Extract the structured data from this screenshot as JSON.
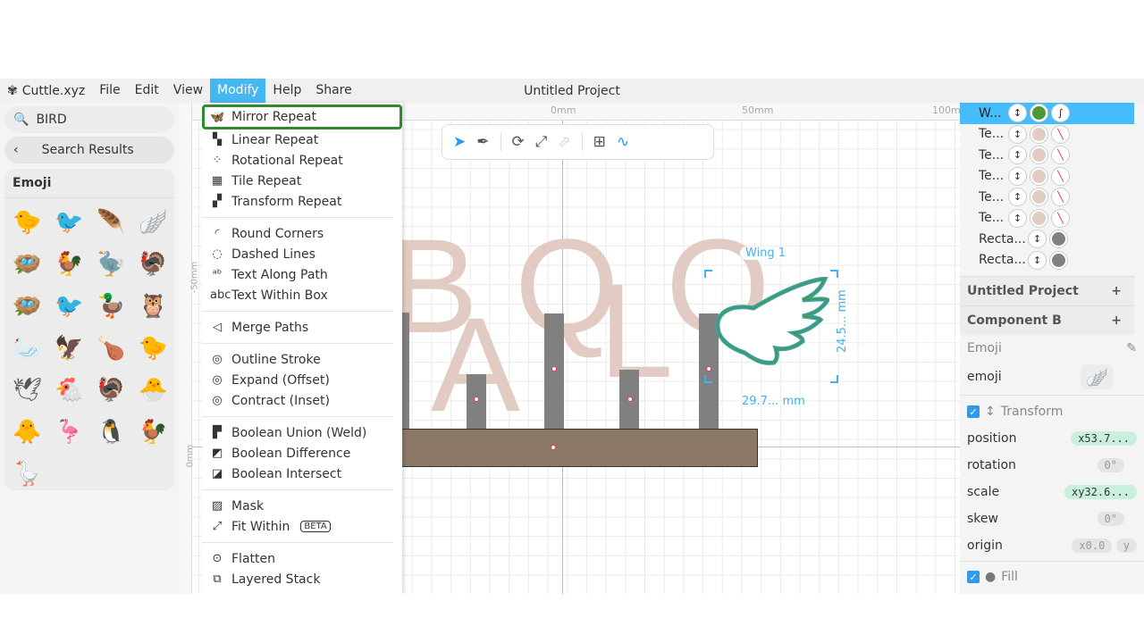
{
  "menubar": {
    "app": "Cuttle.xyz",
    "items": [
      "File",
      "Edit",
      "View",
      "Modify",
      "Help",
      "Share"
    ],
    "active": "Modify",
    "title": "Untitled Project"
  },
  "left": {
    "search_value": "BIRD",
    "back_label": "Search Results",
    "section": "Emoji",
    "emojis": [
      "🐤",
      "🐦",
      "🪶",
      "🪽",
      "🪺",
      "🐓",
      "🦤",
      "🦃",
      "🪺",
      "🐦",
      "🦆",
      "🦉",
      "🦢",
      "🦅",
      "🍗",
      "🐤",
      "🕊",
      "🐔",
      "🦃",
      "🐣",
      "🐥",
      "🦩",
      "🐧",
      "🐓",
      "🪿"
    ]
  },
  "menu": {
    "groups": [
      [
        {
          "icon": "mirror-repeat",
          "glyph": "🦋",
          "label": "Mirror Repeat"
        },
        {
          "icon": "linear-repeat",
          "glyph": "▚",
          "label": "Linear Repeat"
        },
        {
          "icon": "rotational-repeat",
          "glyph": "⁘",
          "label": "Rotational Repeat"
        },
        {
          "icon": "tile-repeat",
          "glyph": "▦",
          "label": "Tile Repeat"
        },
        {
          "icon": "transform-repeat",
          "glyph": "▞",
          "label": "Transform Repeat"
        }
      ],
      [
        {
          "icon": "round-corners",
          "glyph": "◜",
          "label": "Round Corners"
        },
        {
          "icon": "dashed-lines",
          "glyph": "◌",
          "label": "Dashed Lines"
        },
        {
          "icon": "text-along-path",
          "glyph": "ᵃᵇ",
          "label": "Text Along Path"
        },
        {
          "icon": "text-within-box",
          "glyph": "abc",
          "label": "Text Within Box"
        }
      ],
      [
        {
          "icon": "merge-paths",
          "glyph": "◁",
          "label": "Merge Paths"
        }
      ],
      [
        {
          "icon": "outline-stroke",
          "glyph": "◎",
          "label": "Outline Stroke"
        },
        {
          "icon": "expand",
          "glyph": "◎",
          "label": "Expand (Offset)"
        },
        {
          "icon": "contract",
          "glyph": "◎",
          "label": "Contract (Inset)"
        }
      ],
      [
        {
          "icon": "boolean-union",
          "glyph": "▛",
          "label": "Boolean Union (Weld)"
        },
        {
          "icon": "boolean-difference",
          "glyph": "◩",
          "label": "Boolean Difference"
        },
        {
          "icon": "boolean-intersect",
          "glyph": "◪",
          "label": "Boolean Intersect"
        }
      ],
      [
        {
          "icon": "mask",
          "glyph": "▨",
          "label": "Mask"
        },
        {
          "icon": "fit-within",
          "glyph": "⤢",
          "label": "Fit Within",
          "badge": "BETA"
        }
      ],
      [
        {
          "icon": "flatten",
          "glyph": "⊙",
          "label": "Flatten"
        },
        {
          "icon": "layered-stack",
          "glyph": "⧉",
          "label": "Layered Stack"
        }
      ]
    ]
  },
  "canvas": {
    "ruler_top": [
      "0mm",
      "50mm",
      "100mm"
    ],
    "ruler_left": [
      "-50mm",
      "0mm"
    ],
    "letters": [
      "B",
      "A",
      "Q",
      "L",
      "O"
    ],
    "selection_label": "Wing 1",
    "width_label": "29.7... mm",
    "height_label": "24.5... mm",
    "colors": {
      "accent": "#45b8f2",
      "letter": "#e2cbc2",
      "bar": "#8b7866",
      "wing": "#3aa0b0"
    }
  },
  "right": {
    "layers": [
      {
        "name": "W...",
        "fill": "#4a9a3a",
        "stroke": "curve",
        "selected": true
      },
      {
        "name": "Te...",
        "fill": "#e2cbc2",
        "stroke": "none"
      },
      {
        "name": "Te...",
        "fill": "#e2cbc2",
        "stroke": "none"
      },
      {
        "name": "Te...",
        "fill": "#e2cbc2",
        "stroke": "none"
      },
      {
        "name": "Te...",
        "fill": "#e2cbc2",
        "stroke": "none"
      },
      {
        "name": "Te...",
        "fill": "#e2cbc2",
        "stroke": "none"
      },
      {
        "name": "Recta...",
        "fill": "#808080"
      },
      {
        "name": "Recta...",
        "fill": "#808080"
      }
    ],
    "project": "Untitled Project",
    "component": "Component B",
    "emoji_label": "Emoji",
    "emoji_param": "emoji",
    "emoji_value": "🪽",
    "transform": {
      "label": "Transform",
      "position_label": "position",
      "position": "x53.7...",
      "rotation_label": "rotation",
      "rotation": "0°",
      "scale_label": "scale",
      "scale": "xy32.6...",
      "skew_label": "skew",
      "skew": "0°",
      "origin_label": "origin",
      "origin_x": "x0.0",
      "origin_y": "y"
    },
    "fill_label": "Fill"
  }
}
